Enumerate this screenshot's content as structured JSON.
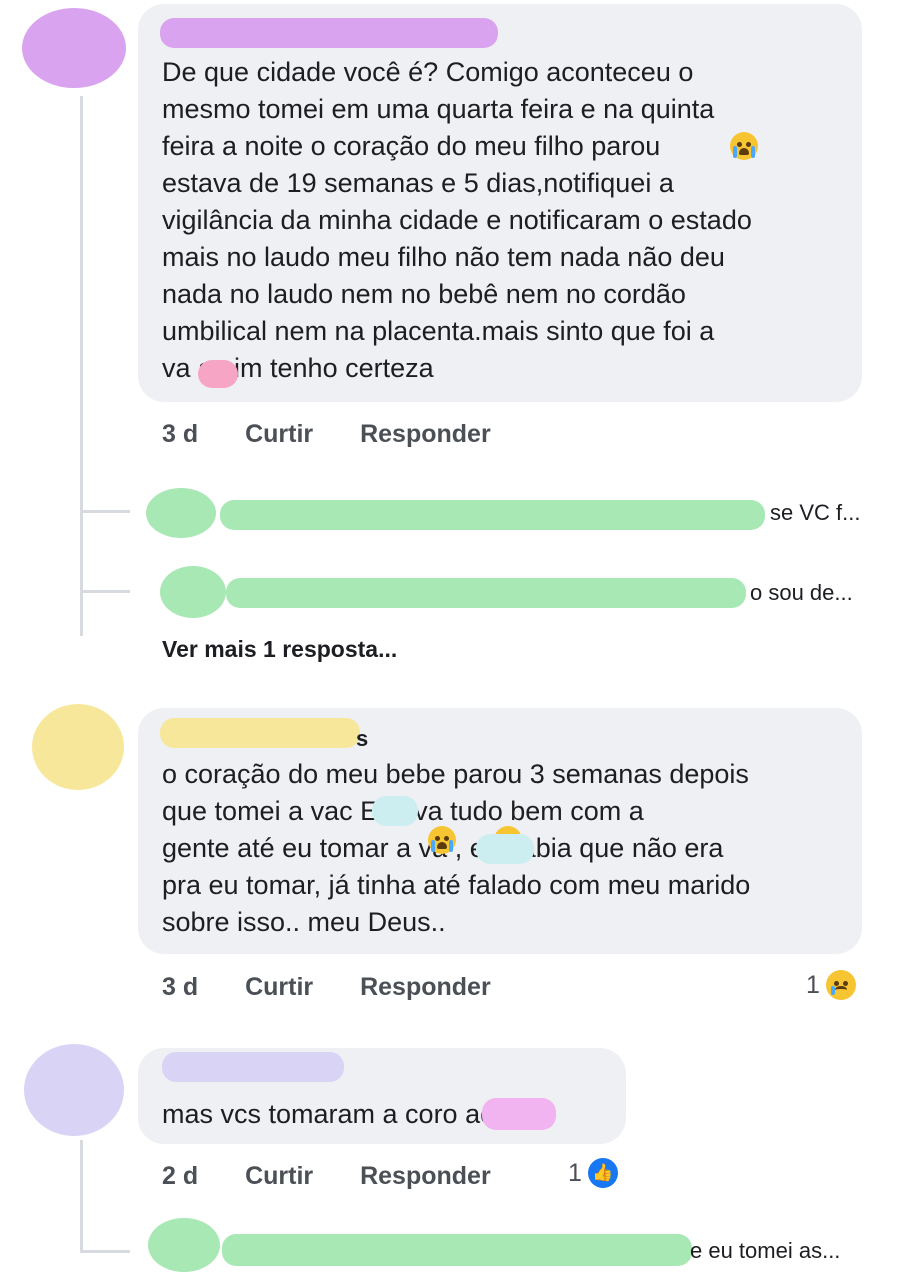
{
  "comments": [
    {
      "text": "De que cidade você é? Comigo aconteceu o\nmesmo tomei em uma quarta feira e na quinta\nfeira a noite o coração do meu filho parou\nestava de 19 semanas e 5 dias,notifiquei a\nvigilância da minha cidade e notificaram o estado\nmais no laudo meu filho não tem nada não deu\nnada no laudo nem no bebê nem no cordão\numbilical nem na placenta.mais sinto que foi a\nva a sim tenho certeza",
      "time": "3 d",
      "like": "Curtir",
      "reply": "Responder",
      "avatar_color": "#d9a3ef",
      "name_color": "#d9a3ef",
      "replies": [
        {
          "snippet": "se VC f...",
          "avatar_color": "#a8e8b4"
        },
        {
          "snippet": "o sou de...",
          "avatar_color": "#a8e8b4"
        }
      ],
      "more_replies": "Ver mais 1 resposta..."
    },
    {
      "name_suffix": "s",
      "text": "o coração do meu bebe parou 3 semanas depois\nque tomei a vac Estava tudo bem com a\ngente até eu tomar a va , eu sabia que não era\npra eu tomar, já tinha até falado com meu marido\nsobre isso.. meu Deus..",
      "time": "3 d",
      "like": "Curtir",
      "reply": "Responder",
      "reaction_count": "1",
      "reaction_icon": "sad-icon",
      "avatar_color": "#f7e79a",
      "name_color": "#f7e79a"
    },
    {
      "text": "mas vcs tomaram a coro ac?",
      "time": "2 d",
      "like": "Curtir",
      "reply": "Responder",
      "reaction_count": "1",
      "reaction_icon": "like-icon",
      "avatar_color": "#d9d3f6",
      "name_color": "#d9d3f6",
      "replies": [
        {
          "snippet": "e eu tomei as...",
          "avatar_color": "#a8e8b4"
        }
      ]
    }
  ]
}
